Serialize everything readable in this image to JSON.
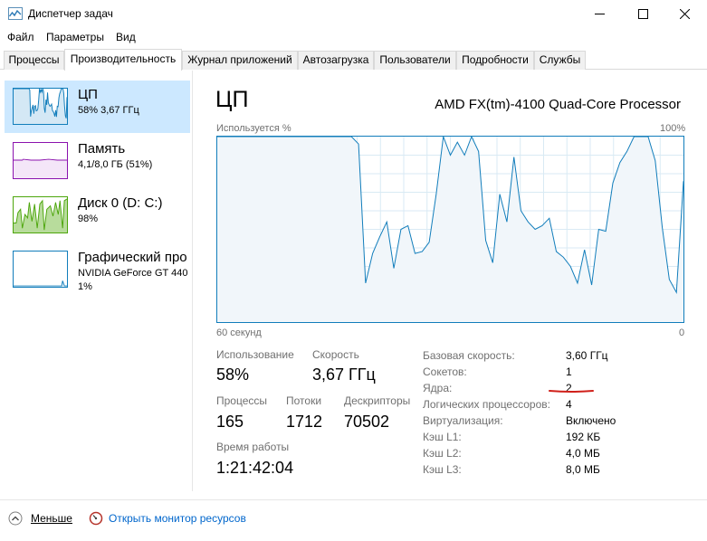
{
  "window": {
    "title": "Диспетчер задач"
  },
  "menu": [
    "Файл",
    "Параметры",
    "Вид"
  ],
  "tabs": [
    "Процессы",
    "Производительность",
    "Журнал приложений",
    "Автозагрузка",
    "Пользователи",
    "Подробности",
    "Службы"
  ],
  "active_tab": "Производительность",
  "sidebar": [
    {
      "title": "ЦП",
      "line1": "58%  3,67 ГГц",
      "line2": "",
      "color": "#117dbb"
    },
    {
      "title": "Память",
      "line1": "4,1/8,0 ГБ (51%)",
      "line2": "",
      "color": "#8b12ae"
    },
    {
      "title": "Диск 0 (D: C:)",
      "line1": "98%",
      "line2": "",
      "color": "#4da60c"
    },
    {
      "title": "Графический про",
      "line1": "NVIDIA GeForce GT 440",
      "line2": "1%",
      "color": "#117dbb"
    }
  ],
  "main": {
    "title": "ЦП",
    "cpu_model": "AMD FX(tm)-4100 Quad-Core Processor",
    "graph": {
      "top_left": "Используется %",
      "top_right": "100%",
      "bottom_left": "60 секунд",
      "bottom_right": "0",
      "color": "#117dbb",
      "fill": "#f1f6fa",
      "grid_color": "#d9eaf4"
    },
    "stats": {
      "usage_label": "Использование",
      "usage_value": "58%",
      "speed_label": "Скорость",
      "speed_value": "3,67 ГГц",
      "processes_label": "Процессы",
      "processes_value": "165",
      "threads_label": "Потоки",
      "threads_value": "1712",
      "handles_label": "Дескрипторы",
      "handles_value": "70502",
      "uptime_label": "Время работы",
      "uptime_value": "1:21:42:04"
    },
    "properties": [
      {
        "label": "Базовая скорость:",
        "value": "3,60 ГГц"
      },
      {
        "label": "Сокетов:",
        "value": "1"
      },
      {
        "label": "Ядра:",
        "value": "2"
      },
      {
        "label": "Логических процессоров:",
        "value": "4"
      },
      {
        "label": "Виртуализация:",
        "value": "Включено"
      },
      {
        "label": "Кэш L1:",
        "value": "192 КБ"
      },
      {
        "label": "Кэш L2:",
        "value": "4,0 МБ"
      },
      {
        "label": "Кэш L3:",
        "value": "8,0 МБ"
      }
    ]
  },
  "footer": {
    "fewer_details": "Меньше",
    "resource_monitor": "Открыть монитор ресурсов"
  },
  "cpu_history": [
    100,
    100,
    100,
    100,
    100,
    100,
    100,
    100,
    100,
    100,
    100,
    100,
    100,
    100,
    100,
    100,
    100,
    100,
    100,
    100,
    96,
    21,
    37,
    46,
    54,
    29,
    50,
    52,
    37,
    38,
    43,
    69,
    100,
    90,
    97,
    90,
    100,
    92,
    44,
    32,
    69,
    54,
    89,
    60,
    54,
    50,
    52,
    56,
    38,
    35,
    30,
    21,
    39,
    20,
    50,
    49,
    75,
    86,
    92,
    100,
    100,
    100,
    87,
    51,
    23,
    16,
    76
  ]
}
